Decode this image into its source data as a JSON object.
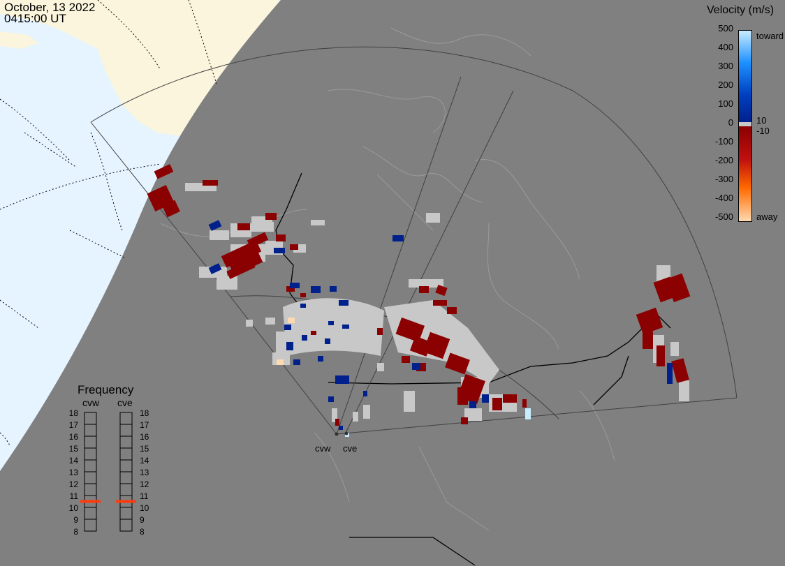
{
  "header": {
    "date": "October, 13 2022",
    "time": "0415:00 UT"
  },
  "colorbar": {
    "title": "Velocity (m/s)",
    "ticks": [
      "500",
      "400",
      "300",
      "200",
      "100",
      "0",
      "-100",
      "-200",
      "-300",
      "-400",
      "-500"
    ],
    "inner_ticks": [
      "10",
      "-10"
    ],
    "toward_label": "toward",
    "away_label": "away",
    "colors": {
      "toward_high": "#c8ecff",
      "toward_mid": "#1e90ff",
      "toward_low": "#00208c",
      "away_low": "#8b0000",
      "away_mid": "#ff6a00",
      "away_high": "#ffd9b0",
      "ground_scatter": "#c8c8c8"
    }
  },
  "frequency": {
    "title": "Frequency",
    "radars": [
      {
        "label": "cvw",
        "selected_mhz": 10.5
      },
      {
        "label": "cve",
        "selected_mhz": 10.5
      }
    ],
    "scale": [
      "18",
      "17",
      "16",
      "15",
      "14",
      "13",
      "12",
      "11",
      "10",
      "9",
      "8"
    ],
    "marker_color": "#ff3b0a"
  },
  "radars": [
    {
      "name": "cvw"
    },
    {
      "name": "cve"
    }
  ],
  "map_colors": {
    "ocean": "#e6f4ff",
    "land_day": "#faf5dc",
    "night": "#808080",
    "coastline": "#9a9a9a",
    "border": "#000000"
  }
}
